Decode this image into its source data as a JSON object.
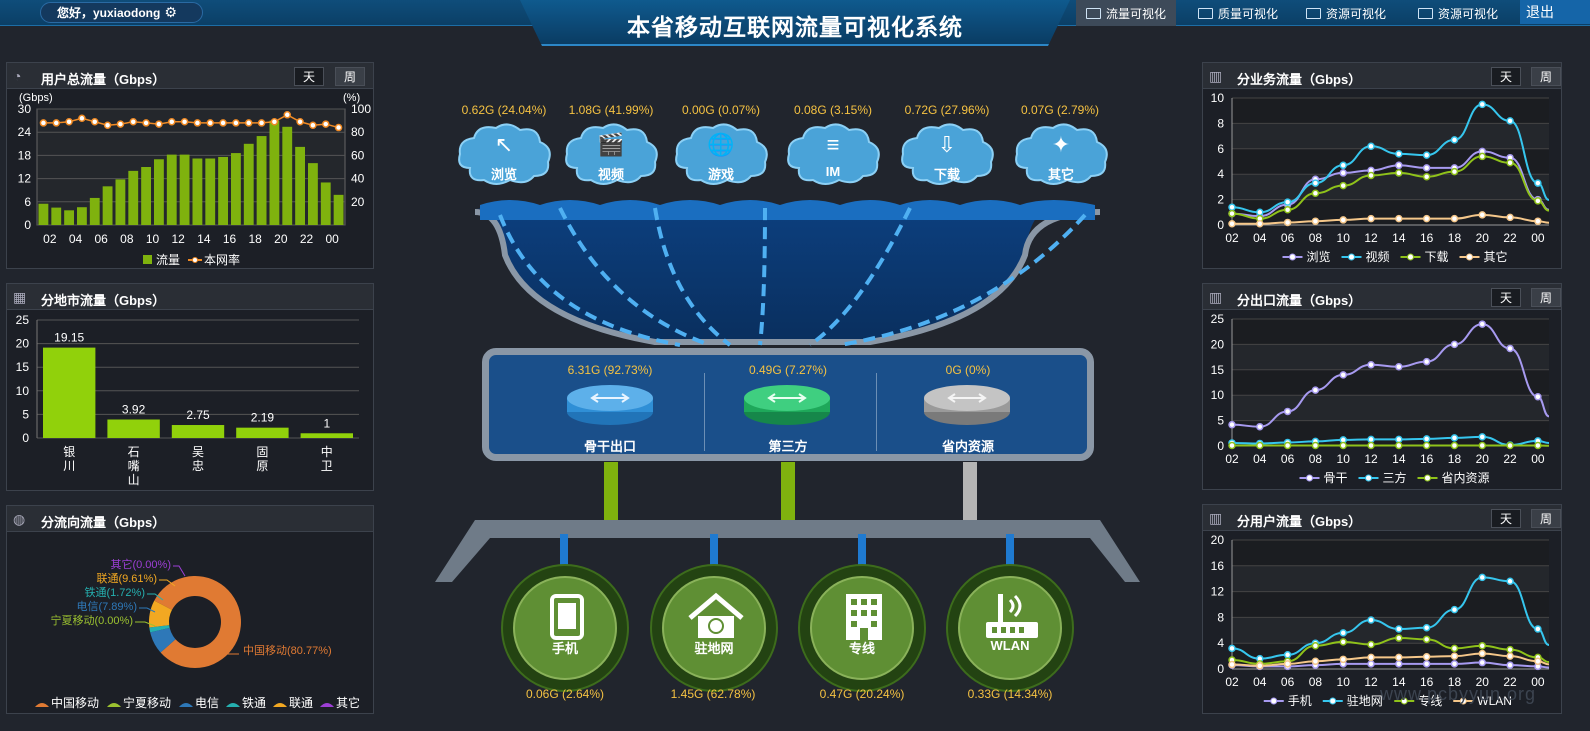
{
  "header": {
    "greeting": "您好，yuxiaodong",
    "title": "本省移动互联网流量可视化系统",
    "logout": "退出",
    "nav": [
      {
        "label": "流量可视化",
        "active": true
      },
      {
        "label": "质量可视化",
        "active": false
      },
      {
        "label": "资源可视化",
        "active": false
      },
      {
        "label": "资源可视化",
        "active": false
      }
    ]
  },
  "toggle": {
    "day": "天",
    "week": "周"
  },
  "panels": {
    "user_total": {
      "title": "用户总流量（Gbps）",
      "left_unit": "(Gbps)",
      "right_unit": "(%)",
      "legend": [
        "流量",
        "本网率"
      ]
    },
    "city": {
      "title": "分地市流量（Gbps）"
    },
    "direction": {
      "title": "分流向流量（Gbps）"
    },
    "service": {
      "title": "分业务流量（Gbps）"
    },
    "exit": {
      "title": "分出口流量（Gbps）"
    },
    "usertype": {
      "title": "分用户流量（Gbps）"
    }
  },
  "services": [
    {
      "label": "0.62G (24.04%)",
      "name": "浏览",
      "icon": "browser-icon"
    },
    {
      "label": "1.08G (41.99%)",
      "name": "视频",
      "icon": "clapper-icon"
    },
    {
      "label": "0.00G (0.07%)",
      "name": "游戏",
      "icon": "globe-icon"
    },
    {
      "label": "0.08G (3.15%)",
      "name": "IM",
      "icon": "database-icon"
    },
    {
      "label": "0.72G (27.96%)",
      "name": "下载",
      "icon": "cloud-download-icon"
    },
    {
      "label": "0.07G (2.79%)",
      "name": "其它",
      "icon": "network-icon"
    }
  ],
  "exits": [
    {
      "label": "6.31G (92.73%)",
      "name": "骨干出口",
      "color": "#2f8fd6"
    },
    {
      "label": "0.49G (7.27%)",
      "name": "第三方",
      "color": "#1ea85a"
    },
    {
      "label": "0G (0%)",
      "name": "省内资源",
      "color": "#9a9a9a"
    }
  ],
  "access": [
    {
      "label": "0.06G (2.64%)",
      "name": "手机",
      "icon": "phone-icon"
    },
    {
      "label": "1.45G (62.78%)",
      "name": "驻地网",
      "icon": "home-icon"
    },
    {
      "label": "0.47G (20.24%)",
      "name": "专线",
      "icon": "building-icon"
    },
    {
      "label": "0.33G (14.34%)",
      "name": "WLAN",
      "icon": "router-icon"
    }
  ],
  "watermark": "www.pcbyyun.org",
  "chart_data": [
    {
      "id": "user_total",
      "type": "bar",
      "x": [
        "01",
        "02",
        "03",
        "04",
        "05",
        "06",
        "07",
        "08",
        "09",
        "10",
        "11",
        "12",
        "13",
        "14",
        "15",
        "16",
        "17",
        "18",
        "19",
        "20",
        "21",
        "22",
        "23",
        "00"
      ],
      "xticks": [
        "02",
        "04",
        "06",
        "08",
        "10",
        "12",
        "14",
        "16",
        "18",
        "20",
        "22",
        "00"
      ],
      "yticks_left": [
        0,
        6,
        12,
        18,
        24,
        30
      ],
      "yticks_right": [
        20,
        40,
        60,
        80,
        100
      ],
      "ylim": [
        0,
        30
      ],
      "ylim_right": [
        0,
        100
      ],
      "series": [
        {
          "name": "流量",
          "type": "bar",
          "color": "#7fb20e",
          "values": [
            5.5,
            4.5,
            3.8,
            4.6,
            7,
            10,
            11.8,
            14,
            15,
            17,
            18.2,
            18.2,
            17.2,
            17.2,
            17.6,
            18.6,
            21,
            23,
            27,
            25.4,
            20.2,
            16,
            11,
            7.8
          ]
        },
        {
          "name": "本网率",
          "type": "line",
          "color": "#f08a24",
          "values": [
            88,
            88,
            89,
            92,
            89,
            86,
            87,
            89,
            88,
            87,
            89,
            89,
            88,
            88,
            88,
            88,
            88,
            88,
            89,
            95,
            89,
            86,
            87,
            84
          ]
        }
      ]
    },
    {
      "id": "city",
      "type": "bar",
      "categories": [
        "银川",
        "石嘴山",
        "吴忠",
        "固原",
        "中卫"
      ],
      "values": [
        19.15,
        3.92,
        2.75,
        2.19,
        1
      ],
      "labels": [
        "19.15",
        "3.92",
        "2.75",
        "2.19",
        "1"
      ],
      "yticks": [
        0,
        5,
        10,
        15,
        20,
        25
      ],
      "ylim": [
        0,
        25
      ],
      "color": "#91d10b"
    },
    {
      "id": "direction",
      "type": "pie",
      "series": [
        {
          "name": "中国移动",
          "label": "中国移动(80.77%)",
          "value": 80.77,
          "color": "#e07a33"
        },
        {
          "name": "宁夏移动",
          "label": "宁夏移动(0.00%)",
          "value": 0.0,
          "color": "#9cc230"
        },
        {
          "name": "电信",
          "label": "电信(7.89%)",
          "value": 7.89,
          "color": "#2e78b8"
        },
        {
          "name": "铁通",
          "label": "铁通(1.72%)",
          "value": 1.72,
          "color": "#25b0b0"
        },
        {
          "name": "联通",
          "label": "联通(9.61%)",
          "value": 9.61,
          "color": "#f2a822"
        },
        {
          "name": "其它",
          "label": "其它(0.00%)",
          "value": 0.0,
          "color": "#9d3fd6"
        }
      ]
    },
    {
      "id": "service",
      "type": "line",
      "xticks": [
        "02",
        "04",
        "06",
        "08",
        "10",
        "12",
        "14",
        "16",
        "18",
        "20",
        "22",
        "00"
      ],
      "yticks": [
        0,
        2,
        4,
        6,
        8,
        10
      ],
      "ylim": [
        0,
        10
      ],
      "series": [
        {
          "name": "浏览",
          "color": "#a79af0",
          "values": [
            0.9,
            0.7,
            1.6,
            3.6,
            4.1,
            4.3,
            4.7,
            4.5,
            4.5,
            5.8,
            5.3,
            2
          ]
        },
        {
          "name": "视频",
          "color": "#36c6ee",
          "values": [
            1.4,
            1,
            1.8,
            3.3,
            4.7,
            6.2,
            5.6,
            5.5,
            6.7,
            9.5,
            8.2,
            3.3
          ]
        },
        {
          "name": "下载",
          "color": "#8fc21a",
          "values": [
            0.9,
            0.5,
            1.2,
            2.5,
            3.1,
            3.9,
            4.1,
            3.8,
            4.2,
            5.4,
            4.9,
            1.9
          ]
        },
        {
          "name": "其它",
          "color": "#f5c78a",
          "values": [
            0.1,
            0.1,
            0.2,
            0.3,
            0.4,
            0.5,
            0.5,
            0.5,
            0.5,
            0.8,
            0.6,
            0.3
          ]
        }
      ]
    },
    {
      "id": "exit",
      "type": "line",
      "xticks": [
        "02",
        "04",
        "06",
        "08",
        "10",
        "12",
        "14",
        "16",
        "18",
        "20",
        "22",
        "00"
      ],
      "yticks": [
        0,
        5,
        10,
        15,
        20,
        25
      ],
      "ylim": [
        0,
        25
      ],
      "series": [
        {
          "name": "骨干",
          "color": "#a79af0",
          "values": [
            4.2,
            3.8,
            6.8,
            11,
            14,
            16,
            15.6,
            16.6,
            20,
            24,
            19.2,
            9.7
          ]
        },
        {
          "name": "三方",
          "color": "#36c6ee",
          "values": [
            0.6,
            0.5,
            0.7,
            0.9,
            1.2,
            1.3,
            1.3,
            1.4,
            1.6,
            1.8,
            0.2,
            1
          ]
        },
        {
          "name": "省内资源",
          "color": "#8fc21a",
          "values": [
            0.1,
            0.1,
            0.1,
            0.1,
            0.1,
            0.1,
            0.1,
            0.1,
            0.1,
            0.1,
            0.1,
            0.1
          ]
        }
      ]
    },
    {
      "id": "usertype",
      "type": "line",
      "xticks": [
        "02",
        "04",
        "06",
        "08",
        "10",
        "12",
        "14",
        "16",
        "18",
        "20",
        "22",
        "00"
      ],
      "yticks": [
        0,
        4,
        8,
        12,
        16,
        20
      ],
      "ylim": [
        0,
        20
      ],
      "series": [
        {
          "name": "手机",
          "color": "#a79af0",
          "values": [
            0.6,
            0.4,
            0.4,
            0.6,
            0.8,
            0.8,
            0.8,
            0.8,
            0.8,
            1,
            0.6,
            0.4
          ]
        },
        {
          "name": "驻地网",
          "color": "#36c6ee",
          "values": [
            3.2,
            1.6,
            2.2,
            4,
            5.6,
            7.6,
            6.2,
            6.4,
            9.2,
            14.2,
            13.6,
            6.2
          ]
        },
        {
          "name": "专线",
          "color": "#8fc21a",
          "values": [
            1.4,
            0.8,
            1.2,
            3.6,
            4.2,
            3.8,
            4.8,
            4.6,
            3.2,
            3.6,
            3,
            1.8
          ]
        },
        {
          "name": "WLAN",
          "color": "#f5c78a",
          "values": [
            0.7,
            0.5,
            0.8,
            1.2,
            1.5,
            1.8,
            1.8,
            1.9,
            2,
            2.4,
            2,
            1.2
          ]
        }
      ]
    }
  ]
}
